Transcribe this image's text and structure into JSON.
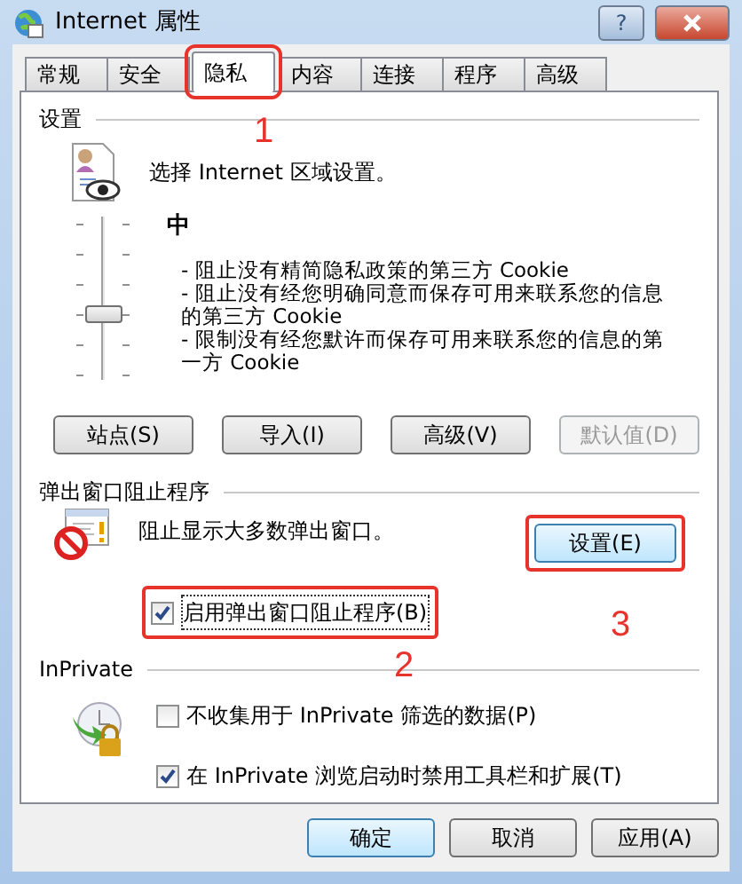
{
  "window": {
    "title": "Internet 属性",
    "help_button": "?"
  },
  "tabs": [
    {
      "label": "常规",
      "selected": false,
      "highlighted": false
    },
    {
      "label": "安全",
      "selected": false,
      "highlighted": false
    },
    {
      "label": "隐私",
      "selected": true,
      "highlighted": true
    },
    {
      "label": "内容",
      "selected": false,
      "highlighted": false
    },
    {
      "label": "连接",
      "selected": false,
      "highlighted": false
    },
    {
      "label": "程序",
      "selected": false,
      "highlighted": false
    },
    {
      "label": "高级",
      "selected": false,
      "highlighted": false
    }
  ],
  "settings": {
    "heading": "设置",
    "prompt": "选择 Internet 区域设置。",
    "slider": {
      "level": 0.4
    },
    "level_name": "中",
    "descriptions": [
      "- 阻止没有精简隐私政策的第三方 Cookie",
      "- 阻止没有经您明确同意而保存可用来联系您的信息的第三方 Cookie",
      "- 限制没有经您默许而保存可用来联系您的信息的第一方 Cookie"
    ],
    "buttons": [
      {
        "label": "站点(S)",
        "disabled": false
      },
      {
        "label": "导入(I)",
        "disabled": false
      },
      {
        "label": "高级(V)",
        "disabled": false
      },
      {
        "label": "默认值(D)",
        "disabled": true
      }
    ]
  },
  "popup_blocker": {
    "heading": "弹出窗口阻止程序",
    "text": "阻止显示大多数弹出窗口。",
    "button": {
      "label": "设置(E)",
      "highlighted": true
    },
    "checkbox": {
      "label": "启用弹出窗口阻止程序(B)",
      "checked": true,
      "highlighted": true
    }
  },
  "inprivate": {
    "heading": "InPrivate",
    "checkboxes": [
      {
        "label": "不收集用于 InPrivate 筛选的数据(P)",
        "checked": false
      },
      {
        "label": "在 InPrivate 浏览启动时禁用工具栏和扩展(T)",
        "checked": true
      }
    ]
  },
  "annotations": [
    "1",
    "2",
    "3"
  ],
  "buttons": [
    {
      "label": "确定",
      "default": true
    },
    {
      "label": "取消",
      "default": false
    },
    {
      "label": "应用(A)",
      "default": false
    }
  ]
}
